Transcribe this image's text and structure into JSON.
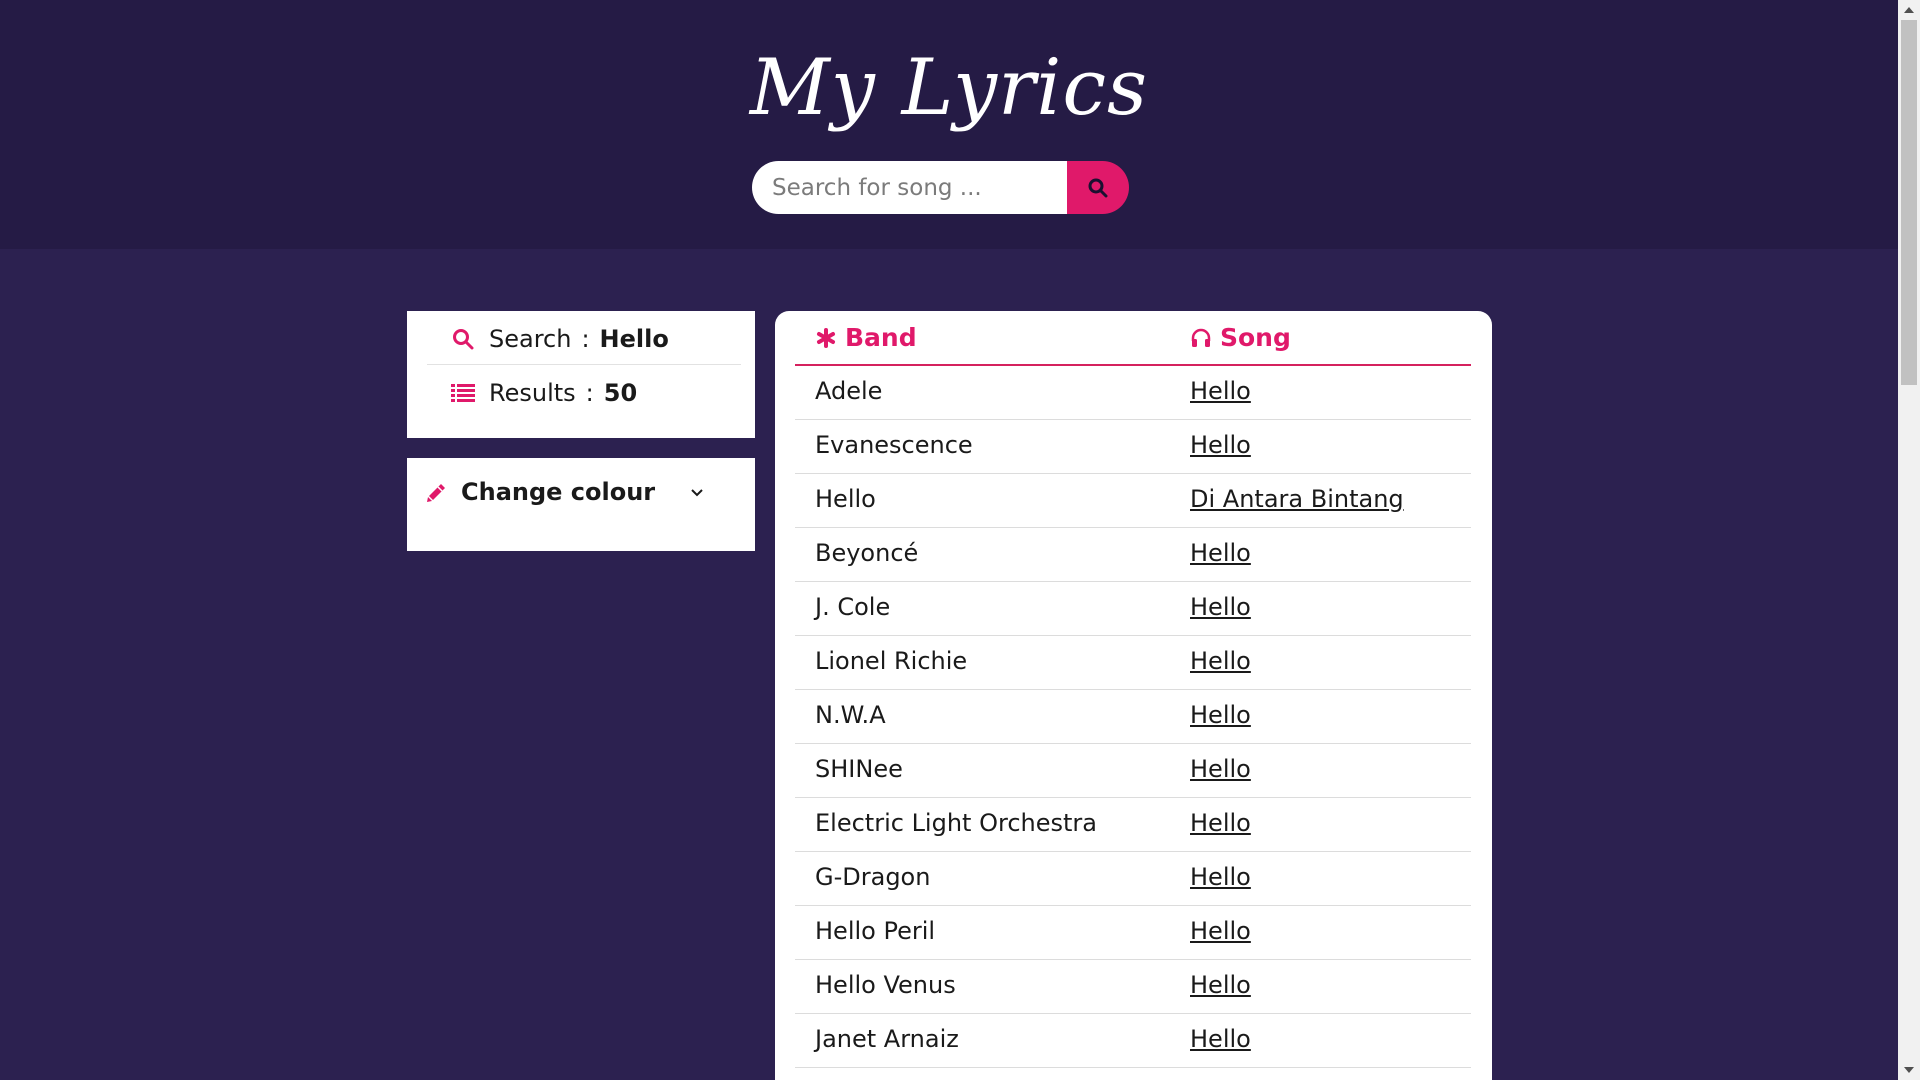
{
  "header": {
    "brand": "My Lyrics",
    "search_placeholder": "Search for song ...",
    "search_value": ""
  },
  "summary": {
    "search_label": "Search",
    "search_term": "Hello",
    "results_label": "Results",
    "results_count": "50",
    "separator": ":"
  },
  "colour_panel": {
    "label": "Change colour"
  },
  "table": {
    "band_header": "Band",
    "song_header": "Song",
    "rows": [
      {
        "band": "Adele",
        "song": "Hello"
      },
      {
        "band": "Evanescence",
        "song": "Hello"
      },
      {
        "band": "Hello",
        "song": "Di Antara Bintang"
      },
      {
        "band": "Beyoncé",
        "song": "Hello"
      },
      {
        "band": "J. Cole",
        "song": "Hello"
      },
      {
        "band": "Lionel Richie",
        "song": "Hello"
      },
      {
        "band": "N.W.A",
        "song": "Hello"
      },
      {
        "band": "SHINee",
        "song": "Hello"
      },
      {
        "band": "Electric Light Orchestra",
        "song": "Hello"
      },
      {
        "band": "G-Dragon",
        "song": "Hello"
      },
      {
        "band": "Hello Peril",
        "song": "Hello"
      },
      {
        "band": "Hello Venus",
        "song": "Hello"
      },
      {
        "band": "Janet Arnaiz",
        "song": "Hello"
      },
      {
        "band": "",
        "song": ""
      }
    ]
  },
  "colors": {
    "accent": "#e0196a",
    "header_bg": "#251b45",
    "page_bg": "#2c2150"
  },
  "icons": {
    "search_button": "search-icon",
    "summary_search": "search-icon",
    "summary_results": "list-icon",
    "colour": "pencil-icon",
    "colour_toggle": "chevron-down-icon",
    "band_header": "asterisk-icon",
    "song_header": "headphones-icon"
  }
}
